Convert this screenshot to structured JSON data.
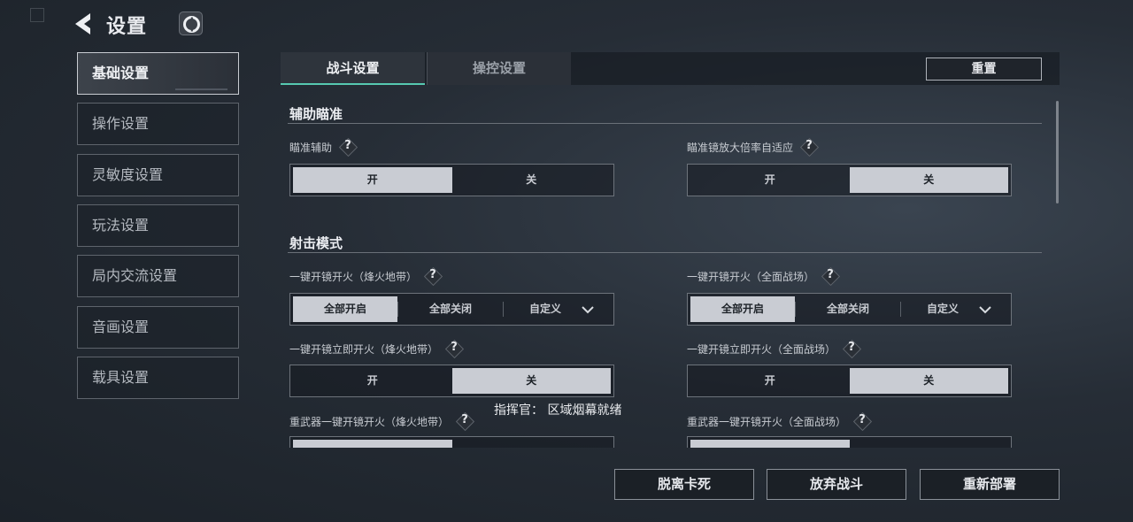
{
  "header": {
    "title": "设置",
    "back_icon": "back-arrow-icon",
    "logo_icon": "game-logo-icon"
  },
  "sidebar": {
    "items": [
      {
        "label": "基础设置",
        "active": true
      },
      {
        "label": "操作设置"
      },
      {
        "label": "灵敏度设置"
      },
      {
        "label": "玩法设置"
      },
      {
        "label": "局内交流设置"
      },
      {
        "label": "音画设置"
      },
      {
        "label": "载具设置"
      }
    ]
  },
  "tabs": [
    {
      "label": "战斗设置",
      "active": true
    },
    {
      "label": "操控设置"
    }
  ],
  "reset_label": "重置",
  "sections": {
    "aim_assist": {
      "title": "辅助瞄准",
      "aim_assist": {
        "label": "瞄准辅助",
        "on": "开",
        "off": "关",
        "selected": "开"
      },
      "scope_adapt": {
        "label": "瞄准镜放大倍率自适应",
        "on": "开",
        "off": "关",
        "selected": "关"
      }
    },
    "fire_mode": {
      "title": "射击模式",
      "scope_fire_warzone": {
        "label": "一键开镜开火（烽火地带）",
        "options": [
          "全部开启",
          "全部关闭",
          "自定义"
        ],
        "selected": "全部开启"
      },
      "scope_fire_battlefield": {
        "label": "一键开镜开火（全面战场）",
        "options": [
          "全部开启",
          "全部关闭",
          "自定义"
        ],
        "selected": "全部开启"
      },
      "instant_fire_warzone": {
        "label": "一键开镜立即开火（烽火地带）",
        "on": "开",
        "off": "关",
        "selected": "关"
      },
      "instant_fire_battlefield": {
        "label": "一键开镜立即开火（全面战场）",
        "on": "开",
        "off": "关",
        "selected": "关"
      },
      "heavy_fire_warzone": {
        "label": "重武器一键开镜开火（烽火地带）"
      },
      "heavy_fire_battlefield": {
        "label": "重武器一键开镜开火（全面战场）"
      }
    }
  },
  "help_glyph": "?",
  "toast": "指挥官：  区域烟幕就绪",
  "bottom_buttons": {
    "unstuck": "脱离卡死",
    "abandon": "放弃战斗",
    "redeploy": "重新部署"
  },
  "colors": {
    "accent": "#56c9b0",
    "selected_option": "#c9ccd3"
  }
}
